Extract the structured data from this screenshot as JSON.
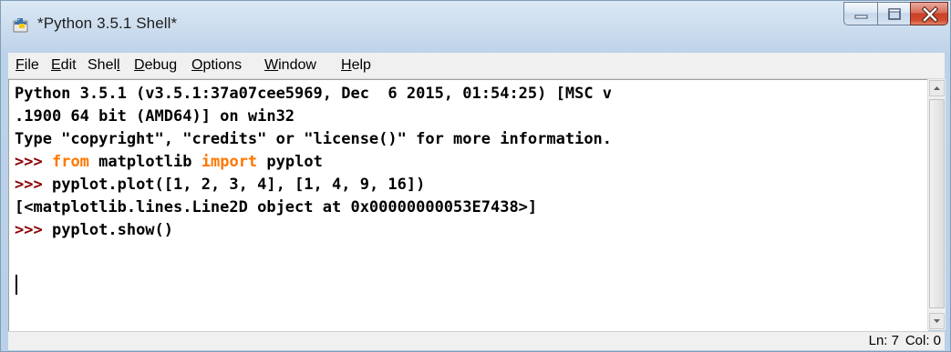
{
  "window": {
    "title": "*Python 3.5.1 Shell*",
    "icon": "python-idle-icon"
  },
  "controls": {
    "minimize_icon": "minimize-icon",
    "maximize_icon": "maximize-icon",
    "close_icon": "close-icon"
  },
  "menu": {
    "items": [
      {
        "label": "File",
        "accel": "F"
      },
      {
        "label": "Edit",
        "accel": "E"
      },
      {
        "label": "Shell",
        "accel": "l"
      },
      {
        "label": "Debug",
        "accel": "D"
      },
      {
        "label": "Options",
        "accel": "O"
      },
      {
        "label": "Window",
        "accel": "W"
      },
      {
        "label": "Help",
        "accel": "H"
      }
    ]
  },
  "shell": {
    "lines": [
      {
        "type": "banner",
        "text": "Python 3.5.1 (v3.5.1:37a07cee5969, Dec  6 2015, 01:54:25) [MSC v"
      },
      {
        "type": "banner",
        "text": ".1900 64 bit (AMD64)] on win32"
      },
      {
        "type": "banner",
        "text": "Type \"copyright\", \"credits\" or \"license()\" for more information."
      },
      {
        "type": "input",
        "prompt": ">>>",
        "kw1": "from",
        "mid": " matplotlib ",
        "kw2": "import",
        "tail": " pyplot"
      },
      {
        "type": "input",
        "prompt": ">>>",
        "text": " pyplot.plot([1, 2, 3, 4], [1, 4, 9, 16])"
      },
      {
        "type": "output",
        "text": "[<matplotlib.lines.Line2D object at 0x00000000053E7438>]"
      },
      {
        "type": "input",
        "prompt": ">>>",
        "text": " pyplot.show()"
      }
    ]
  },
  "status": {
    "line": "Ln: 7",
    "col": "Col: 0"
  },
  "colors": {
    "prompt": "#8b0000",
    "keyword": "#ff7700",
    "output": "#0000ff"
  }
}
